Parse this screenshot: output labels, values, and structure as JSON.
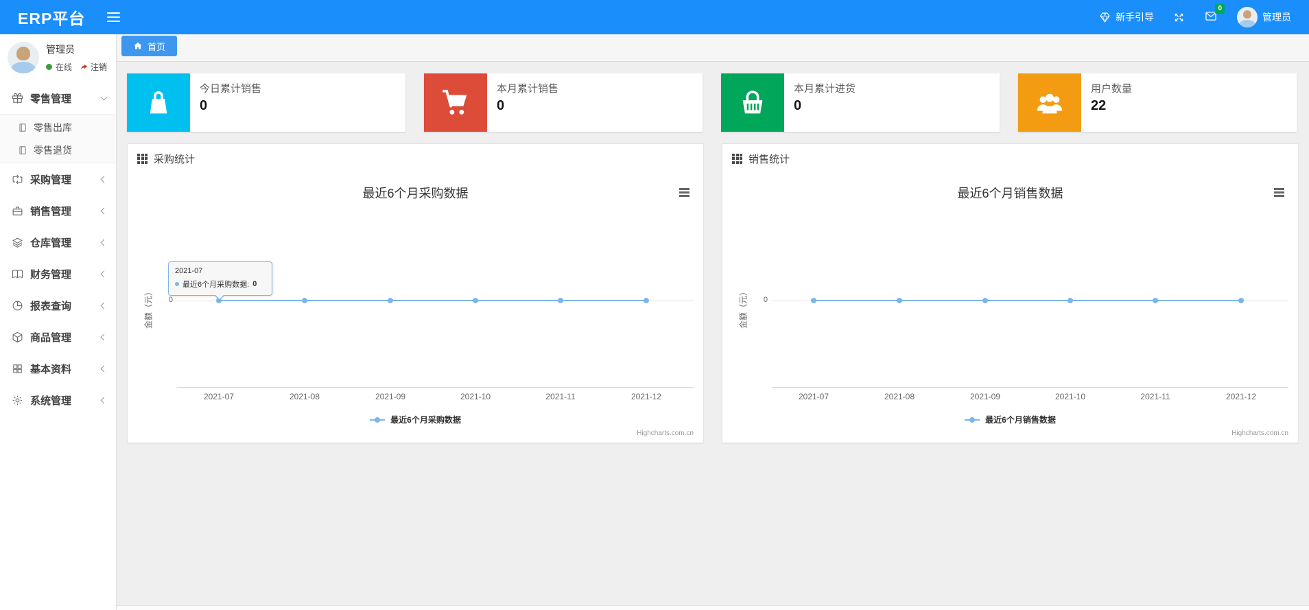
{
  "navbar": {
    "logo": "ERP平台",
    "guide_label": "新手引导",
    "badge_count": "0",
    "username": "管理员",
    "icons": [
      "menu-icon",
      "gem-icon",
      "fullscreen-icon",
      "envelope-icon",
      "avatar"
    ],
    "accent_color": "#1a8ffc"
  },
  "sidebar": {
    "user": {
      "name": "管理员",
      "status": "在线",
      "logout": "注销",
      "status_color": "#3a9d3a"
    },
    "items": [
      {
        "label": "零售管理",
        "icon": "gift-icon",
        "expanded": true,
        "children": [
          {
            "label": "零售出库",
            "icon": "journal-icon"
          },
          {
            "label": "零售退货",
            "icon": "journal-icon"
          }
        ]
      },
      {
        "label": "采购管理",
        "icon": "repeat-icon"
      },
      {
        "label": "销售管理",
        "icon": "briefcase-icon"
      },
      {
        "label": "仓库管理",
        "icon": "layers-icon"
      },
      {
        "label": "财务管理",
        "icon": "book-open-icon"
      },
      {
        "label": "报表查询",
        "icon": "pie-chart-icon"
      },
      {
        "label": "商品管理",
        "icon": "box-icon"
      },
      {
        "label": "基本资料",
        "icon": "grid-icon"
      },
      {
        "label": "系统管理",
        "icon": "gear-icon"
      }
    ]
  },
  "tabs": [
    {
      "label": "首页",
      "icon": "home-icon",
      "active": true,
      "color": "#3e97ee"
    }
  ],
  "stats": [
    {
      "label": "今日累计销售",
      "value": "0",
      "icon": "shopping-bag-icon",
      "color": "#00c0ef"
    },
    {
      "label": "本月累计销售",
      "value": "0",
      "icon": "shopping-cart-icon",
      "color": "#dd4b39"
    },
    {
      "label": "本月累计进货",
      "value": "0",
      "icon": "shopping-basket-icon",
      "color": "#00a65a"
    },
    {
      "label": "用户数量",
      "value": "22",
      "icon": "users-icon",
      "color": "#f39c12"
    }
  ],
  "panels": [
    {
      "title": "采购统计",
      "icon": "th-grid-icon"
    },
    {
      "title": "销售统计",
      "icon": "th-grid-icon"
    }
  ],
  "chart_data": [
    {
      "type": "line",
      "title": "最近6个月采购数据",
      "x": [
        "2021-07",
        "2021-08",
        "2021-09",
        "2021-10",
        "2021-11",
        "2021-12"
      ],
      "series": [
        {
          "name": "最近6个月采购数据",
          "values": [
            0,
            0,
            0,
            0,
            0,
            0
          ]
        }
      ],
      "ylabel": "金额（元）",
      "y_ticks": [
        "0"
      ],
      "line_color": "#7cb5ec",
      "legend_position": "bottom",
      "grid": false,
      "credits": "Highcharts.com.cn",
      "tooltip": {
        "x": "2021-07",
        "label": "最近6个月采购数据: ",
        "value": "0"
      }
    },
    {
      "type": "line",
      "title": "最近6个月销售数据",
      "x": [
        "2021-07",
        "2021-08",
        "2021-09",
        "2021-10",
        "2021-11",
        "2021-12"
      ],
      "series": [
        {
          "name": "最近6个月销售数据",
          "values": [
            0,
            0,
            0,
            0,
            0,
            0
          ]
        }
      ],
      "ylabel": "金额（元）",
      "y_ticks": [
        "0"
      ],
      "line_color": "#7cb5ec",
      "legend_position": "bottom",
      "grid": false,
      "credits": "Highcharts.com.cn"
    }
  ]
}
